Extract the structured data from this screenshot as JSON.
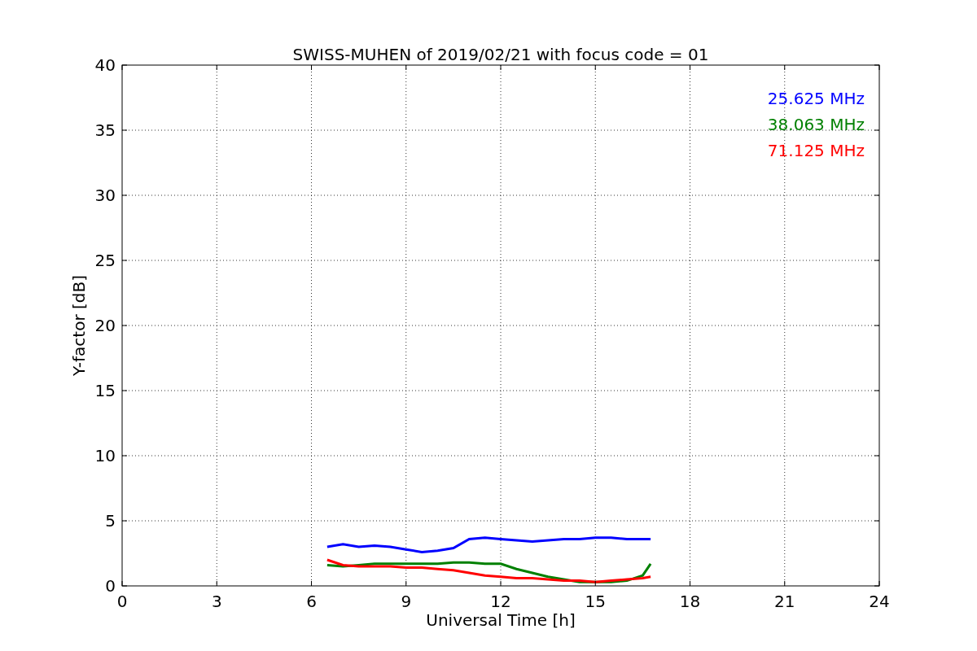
{
  "chart_data": {
    "type": "line",
    "title": "SWISS-MUHEN of 2019/02/21 with focus code = 01",
    "xlabel": "Universal Time [h]",
    "ylabel": "Y-factor [dB]",
    "x": [
      6.5,
      7,
      7.5,
      8,
      8.5,
      9,
      9.5,
      10,
      10.5,
      11,
      11.5,
      12,
      12.5,
      13,
      13.5,
      14,
      14.5,
      15,
      15.5,
      16,
      16.5,
      16.75
    ],
    "series": [
      {
        "name": "25.625 MHz",
        "color": "#0000ff",
        "values": [
          3.0,
          3.2,
          3.0,
          3.1,
          3.0,
          2.8,
          2.6,
          2.7,
          2.9,
          3.6,
          3.7,
          3.6,
          3.5,
          3.4,
          3.5,
          3.6,
          3.6,
          3.7,
          3.7,
          3.6,
          3.6,
          3.6
        ]
      },
      {
        "name": "38.063 MHz",
        "color": "#008000",
        "values": [
          1.6,
          1.5,
          1.6,
          1.7,
          1.7,
          1.7,
          1.7,
          1.7,
          1.8,
          1.8,
          1.7,
          1.7,
          1.3,
          1.0,
          0.7,
          0.5,
          0.3,
          0.3,
          0.3,
          0.4,
          0.8,
          1.7
        ]
      },
      {
        "name": "71.125 MHz",
        "color": "#ff0000",
        "values": [
          2.0,
          1.6,
          1.5,
          1.5,
          1.5,
          1.4,
          1.4,
          1.3,
          1.2,
          1.0,
          0.8,
          0.7,
          0.6,
          0.6,
          0.5,
          0.4,
          0.4,
          0.3,
          0.4,
          0.5,
          0.6,
          0.7
        ]
      }
    ],
    "grid": true,
    "xlim": [
      0,
      24
    ],
    "ylim": [
      0,
      40
    ],
    "xticks": [
      0,
      3,
      6,
      9,
      12,
      15,
      18,
      21,
      24
    ],
    "yticks": [
      0,
      5,
      10,
      15,
      20,
      25,
      30,
      35,
      40
    ]
  }
}
